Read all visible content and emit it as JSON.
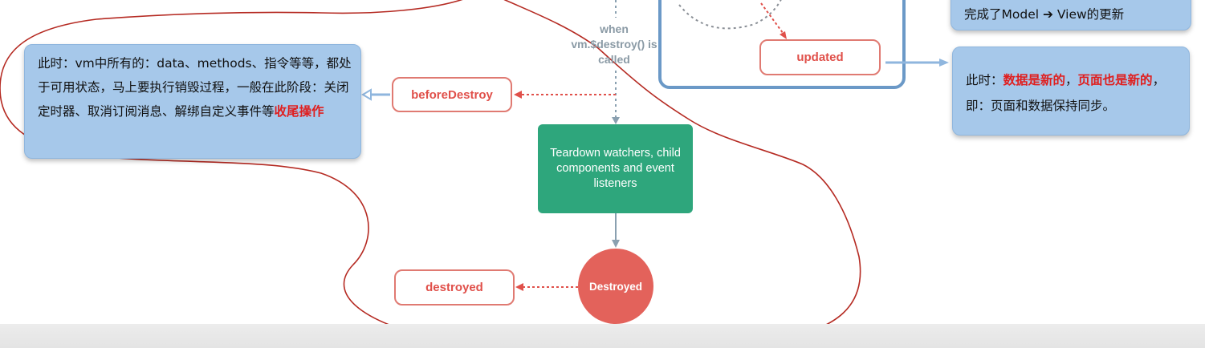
{
  "notes": {
    "left": {
      "prefix": "此时：vm中所有的：data、methods、指令等等，都处于可用状态，马上要执行销毁过程，一般在此阶段：关闭定时器、取消订阅消息、解绑自定义事件等",
      "highlight": "收尾操作"
    },
    "top_right": {
      "text": "完成了Model ➔ View的更新"
    },
    "right": {
      "t1": "此时：",
      "h1": "数据是新的",
      "t2": "，",
      "h2": "页面也是新的",
      "t3": "，即：页面和数据保持同步。"
    }
  },
  "hooks": {
    "beforeDestroy": "beforeDestroy",
    "destroyed": "destroyed",
    "updated": "updated"
  },
  "flow": {
    "when_label": "when vm.$destroy() is called",
    "teardown": "Teardown watchers, child components and event listeners",
    "destroyed_state": "Destroyed"
  },
  "colors": {
    "note_bg": "#a6c8ea",
    "highlight_red": "#e01e1e",
    "hook_red": "#e0504a",
    "teardown_green": "#2ea67c",
    "destroyed_red": "#e3625b",
    "annotation_line": "#b52a22",
    "container_border": "#6b99c7"
  }
}
